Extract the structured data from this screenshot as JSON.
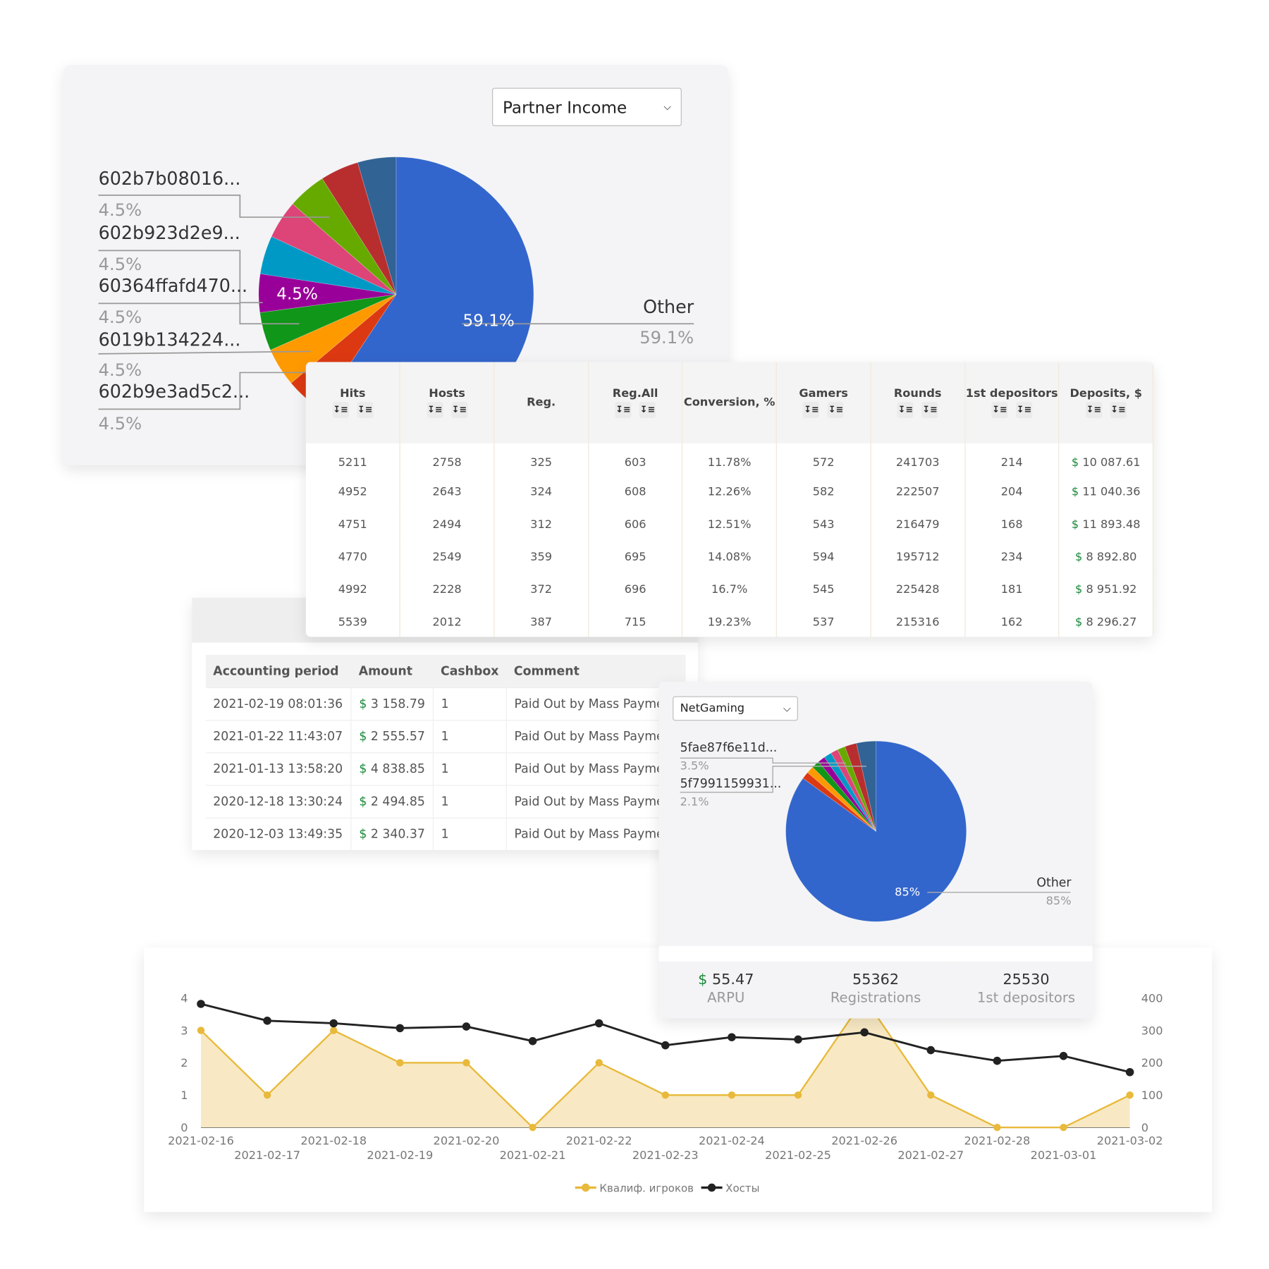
{
  "pie_main": {
    "dropdown": "Partner Income",
    "colors": [
      "#3366cc",
      "#dc3912",
      "#ff9900",
      "#109618",
      "#990099",
      "#0099c6",
      "#dd4477",
      "#66aa00",
      "#b82e2e",
      "#316395"
    ],
    "slices": [
      59.1,
      4.5,
      4.5,
      4.5,
      4.5,
      4.5,
      4.5,
      4.5,
      4.5,
      4.5
    ],
    "inner_labels": [
      "59.1%",
      "4.5%"
    ],
    "legend": [
      {
        "name": "602b7b08016...",
        "pct": "4.5%"
      },
      {
        "name": "602b923d2e9...",
        "pct": "4.5%"
      },
      {
        "name": "60364ffafd470...",
        "pct": "4.5%"
      },
      {
        "name": "6019b134224...",
        "pct": "4.5%"
      },
      {
        "name": "602b9e3ad5c2...",
        "pct": "4.5%"
      }
    ],
    "other": {
      "name": "Other",
      "pct": "59.1%"
    }
  },
  "stats_table": {
    "headers": [
      "Hits",
      "Hosts",
      "Reg.",
      "Reg.All",
      "Conversion, %",
      "Gamers",
      "Rounds",
      "1st depositors",
      "Deposits, $"
    ],
    "sortable": [
      true,
      true,
      false,
      true,
      false,
      true,
      true,
      true,
      true
    ],
    "sort_icons": [
      "sort-amount-asc-icon",
      "sort-amount-desc-icon"
    ],
    "rows": [
      [
        "5211",
        "2758",
        "325",
        "603",
        "11.78%",
        "572",
        "241703",
        "214",
        "10 087.61"
      ],
      [
        "4952",
        "2643",
        "324",
        "608",
        "12.26%",
        "582",
        "222507",
        "204",
        "11 040.36"
      ],
      [
        "4751",
        "2494",
        "312",
        "606",
        "12.51%",
        "543",
        "216479",
        "168",
        "11 893.48"
      ],
      [
        "4770",
        "2549",
        "359",
        "695",
        "14.08%",
        "594",
        "195712",
        "234",
        "8 892.80"
      ],
      [
        "4992",
        "2228",
        "372",
        "696",
        "16.7%",
        "545",
        "225428",
        "181",
        "8 951.92"
      ],
      [
        "5539",
        "2012",
        "387",
        "715",
        "19.23%",
        "537",
        "215316",
        "162",
        "8 296.27"
      ]
    ],
    "currency": "$"
  },
  "payments": {
    "headers": [
      "Accounting period",
      "Amount",
      "Cashbox",
      "Comment"
    ],
    "rows": [
      [
        "2021-02-19 08:01:36",
        "3 158.79",
        "1",
        "Paid Out by Mass Payment"
      ],
      [
        "2021-01-22 11:43:07",
        "2 555.57",
        "1",
        "Paid Out by Mass Payment"
      ],
      [
        "2021-01-13 13:58:20",
        "4 838.85",
        "1",
        "Paid Out by Mass Payment"
      ],
      [
        "2020-12-18 13:30:24",
        "2 494.85",
        "1",
        "Paid Out by Mass Payment"
      ],
      [
        "2020-12-03 13:49:35",
        "2 340.37",
        "1",
        "Paid Out by Mass Payment"
      ]
    ],
    "currency": "$"
  },
  "pie_small": {
    "dropdown": "NetGaming",
    "colors": [
      "#3366cc",
      "#dc3912",
      "#ff9900",
      "#109618",
      "#990099",
      "#0099c6",
      "#dd4477",
      "#66aa00",
      "#b82e2e",
      "#316395"
    ],
    "slices": [
      85,
      1.3,
      1.3,
      1.4,
      1.3,
      1.4,
      1.3,
      1.4,
      2.1,
      3.5
    ],
    "inner_label": "85%",
    "legend": [
      {
        "name": "5fae87f6e11d...",
        "pct": "3.5%"
      },
      {
        "name": "5f7991159931...",
        "pct": "2.1%"
      }
    ],
    "other": {
      "name": "Other",
      "pct": "85%"
    },
    "kpis": [
      {
        "value": "55.47",
        "currency": "$",
        "label": "ARPU"
      },
      {
        "value": "55362",
        "label": "Registrations"
      },
      {
        "value": "25530",
        "label": "1st depositors"
      }
    ]
  },
  "chart_data": {
    "type": "line",
    "x": [
      "2021-02-16",
      "2021-02-17",
      "2021-02-18",
      "2021-02-19",
      "2021-02-20",
      "2021-02-21",
      "2021-02-22",
      "2021-02-23",
      "2021-02-24",
      "2021-02-25",
      "2021-02-26",
      "2021-02-27",
      "2021-02-28",
      "2021-03-01",
      "2021-03-02"
    ],
    "y_left": {
      "ticks": [
        "0",
        "1",
        "2",
        "3",
        "4"
      ],
      "range": [
        0,
        4
      ]
    },
    "y_right": {
      "ticks": [
        "0",
        "100",
        "200",
        "300",
        "400"
      ],
      "range": [
        0,
        400
      ]
    },
    "series": [
      {
        "name": "Квалиф. игроков",
        "axis": "left",
        "color": "#e8b93a",
        "area": true,
        "values": [
          3,
          1,
          3,
          2,
          2,
          0,
          2,
          1,
          1,
          1,
          4,
          1,
          0,
          0,
          1
        ]
      },
      {
        "name": "Хосты",
        "axis": "right",
        "color": "#222222",
        "area": false,
        "values": [
          382,
          330,
          322,
          307,
          312,
          267,
          322,
          254,
          279,
          272,
          294,
          239,
          206,
          221,
          171
        ]
      }
    ],
    "legend_position": "bottom",
    "grid": false
  }
}
